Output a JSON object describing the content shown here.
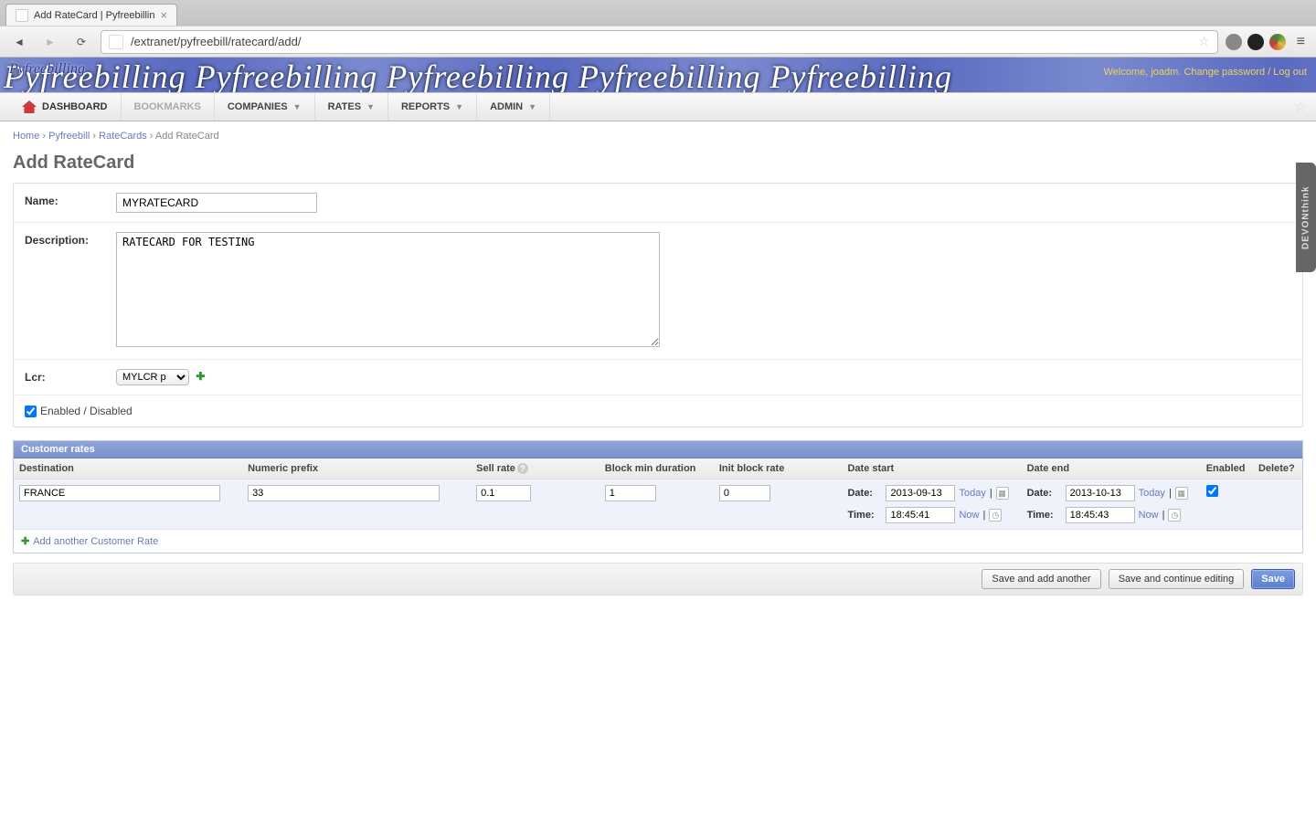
{
  "browser": {
    "tab_title": "Add RateCard | Pyfreebillin",
    "url": "/extranet/pyfreebill/ratecard/add/"
  },
  "banner": {
    "brand": "Pyfreebilling",
    "repeat_text": "Pyfreebilling   Pyfreebilling   Pyfreebilling   Pyfreebilling   Pyfreebilling",
    "welcome": "Welcome, joadm.",
    "change_pw": "Change password",
    "logout": "Log out"
  },
  "menu": {
    "dashboard": "DASHBOARD",
    "bookmarks": "BOOKMARKS",
    "companies": "COMPANIES",
    "rates": "RATES",
    "reports": "REPORTS",
    "admin": "ADMIN"
  },
  "crumbs": {
    "home": "Home",
    "app": "Pyfreebill",
    "model": "RateCards",
    "page": "Add RateCard"
  },
  "title": "Add RateCard",
  "form": {
    "name_label": "Name:",
    "name_value": "MYRATECARD",
    "desc_label": "Description:",
    "desc_value": "RATECARD FOR TESTING",
    "lcr_label": "Lcr:",
    "lcr_value": "MYLCR p",
    "enabled_label": "Enabled / Disabled"
  },
  "inline": {
    "title": "Customer rates",
    "headers": {
      "destination": "Destination",
      "prefix": "Numeric prefix",
      "sell_rate": "Sell rate",
      "block_min": "Block min duration",
      "init_block": "Init block rate",
      "date_start": "Date start",
      "date_end": "Date end",
      "enabled": "Enabled",
      "delete": "Delete?"
    },
    "row": {
      "destination": "FRANCE",
      "prefix": "33",
      "sell_rate": "0.1",
      "block_min": "1",
      "init_block": "0",
      "start_date_label": "Date:",
      "start_date": "2013-09-13",
      "start_time_label": "Time:",
      "start_time": "18:45:41",
      "end_date_label": "Date:",
      "end_date": "2013-10-13",
      "end_time_label": "Time:",
      "end_time": "18:45:43",
      "today": "Today",
      "now": "Now"
    },
    "add_another": "Add another Customer Rate"
  },
  "buttons": {
    "save_add": "Save and add another",
    "save_cont": "Save and continue editing",
    "save": "Save"
  },
  "side_tab": "DEVONthink"
}
